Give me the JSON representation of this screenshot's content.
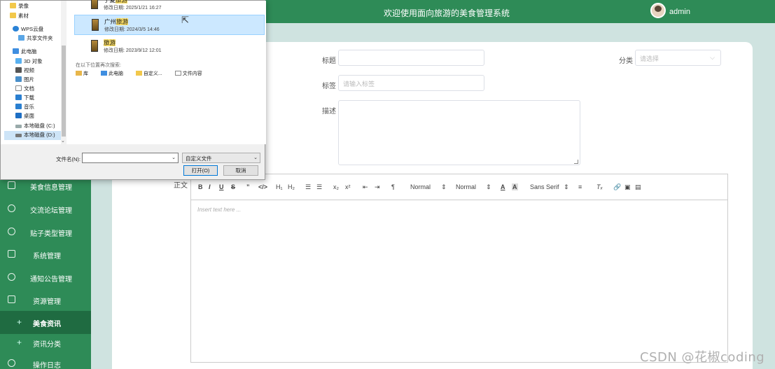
{
  "header": {
    "title": "欢迎使用面向旅游的美食管理系统",
    "user": "admin"
  },
  "sidebar": {
    "items": [
      {
        "label": "美食信息管理"
      },
      {
        "label": "交流论坛管理"
      },
      {
        "label": "贴子类型管理"
      },
      {
        "label": "系统管理"
      },
      {
        "label": "通知公告管理"
      },
      {
        "label": "资源管理"
      },
      {
        "label": "美食资讯",
        "active": true
      },
      {
        "label": "资讯分类"
      },
      {
        "label": "操作日志"
      }
    ]
  },
  "form": {
    "title_label": "标题",
    "category_label": "分类",
    "category_placeholder": "请选择",
    "tag_label": "标签",
    "tag_placeholder": "请输入标签",
    "desc_label": "描述",
    "body_label": "正文"
  },
  "editor": {
    "placeholder": "Insert text here ...",
    "toolbar": {
      "bold": "B",
      "italic": "I",
      "underline": "U",
      "strike": "S",
      "quote": "”",
      "code": "</>",
      "h1": "H₁",
      "h2": "H₂",
      "ordered_list": "☰",
      "bullet_list": "☰",
      "subscript": "x₂",
      "superscript": "x²",
      "outdent": "⇤",
      "indent": "⇥",
      "direction": "¶",
      "size": "Normal",
      "header": "Normal",
      "color": "A",
      "background": "A",
      "font": "Sans Serif",
      "align": "≡",
      "clean": "Tₓ"
    }
  },
  "dialog": {
    "nav": [
      {
        "label": "录像",
        "icon": "folder-icon"
      },
      {
        "label": "素材",
        "icon": "folder-icon"
      },
      {
        "label": "WPS云盘",
        "icon": "cloud-icon"
      },
      {
        "label": "共享文件夹",
        "icon": "share-icon"
      },
      {
        "label": "此电脑",
        "icon": "computer-icon"
      },
      {
        "label": "3D 对象",
        "icon": "cube-icon"
      },
      {
        "label": "视频",
        "icon": "video-icon"
      },
      {
        "label": "图片",
        "icon": "picture-icon"
      },
      {
        "label": "文档",
        "icon": "document-icon"
      },
      {
        "label": "下载",
        "icon": "download-icon"
      },
      {
        "label": "音乐",
        "icon": "music-icon"
      },
      {
        "label": "桌面",
        "icon": "desktop-icon"
      },
      {
        "label": "本地磁盘 (C:)",
        "icon": "disk-icon"
      },
      {
        "label": "本地磁盘 (D:)",
        "icon": "disk-icon",
        "selected": true
      }
    ],
    "files": [
      {
        "name_prefix": "宁夏",
        "name_hl": "旅游",
        "date": "修改日期: 2025/1/21 16:27"
      },
      {
        "name_prefix": "广州",
        "name_hl": "旅游",
        "date": "修改日期: 2024/3/5 14:46",
        "highlighted": true
      },
      {
        "name_prefix": "",
        "name_hl": "旅游",
        "date": "修改日期: 2023/9/12 12:01"
      }
    ],
    "search_hint": "在以下位置再次搜索:",
    "search_links": [
      "库",
      "此电脑",
      "自定义...",
      "文件内容"
    ],
    "filename_label": "文件名(N):",
    "filename_value": "",
    "filetype": "自定义文件",
    "open_button": "打开(O)",
    "cancel_button": "取消"
  },
  "watermark": "CSDN @花椒coding",
  "colors": {
    "primary": "#2e8b57",
    "active": "#1f6b41",
    "background": "#cfe3e0",
    "highlight": "#ffe26b"
  }
}
